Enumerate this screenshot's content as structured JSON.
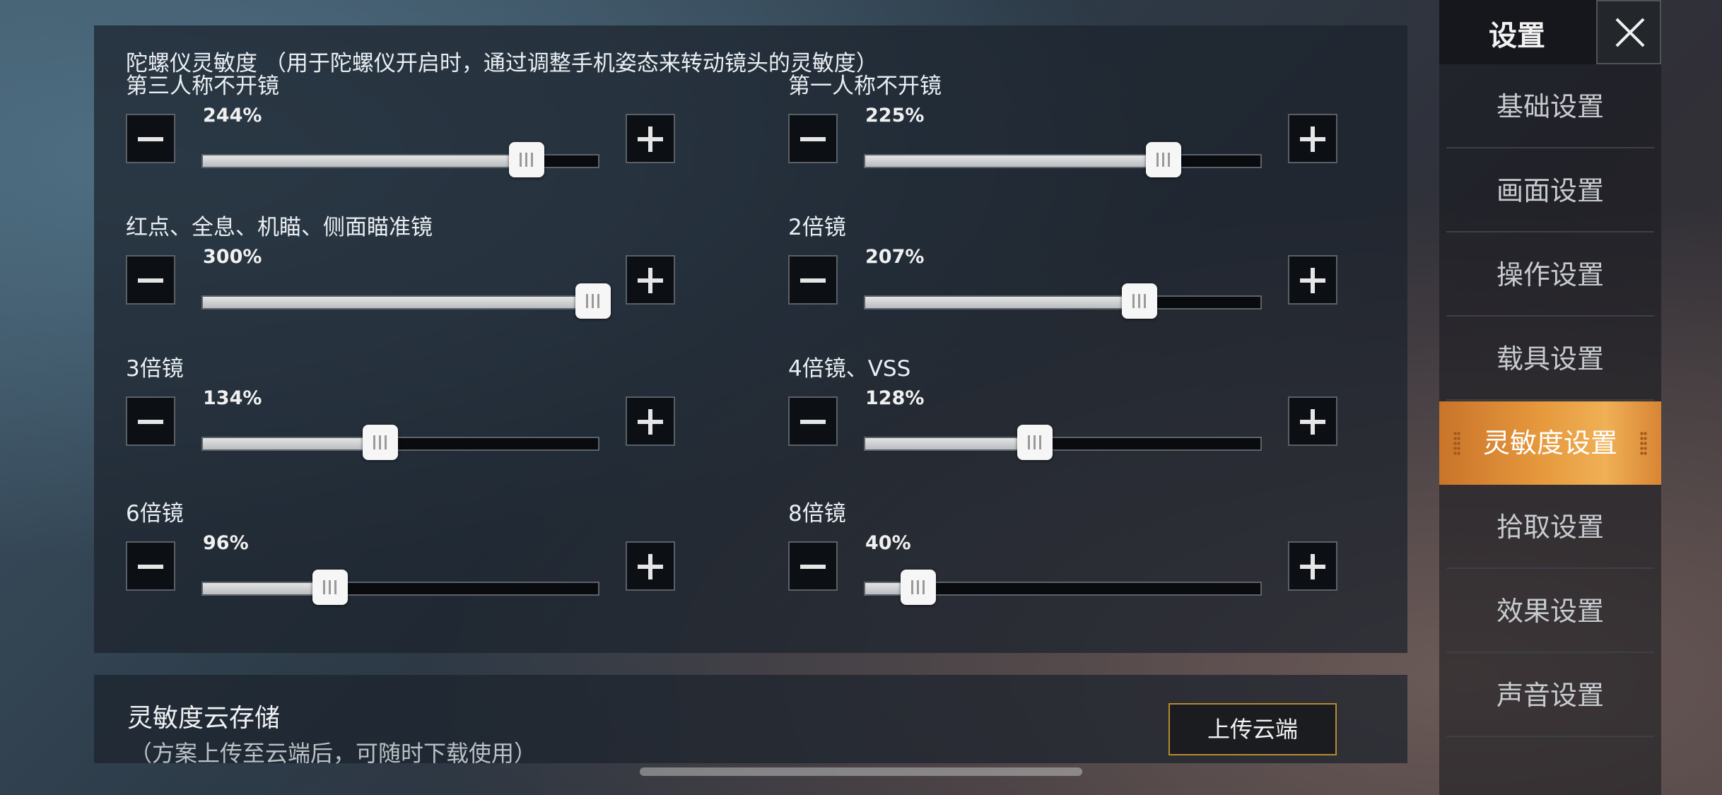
{
  "gyro": {
    "title": "陀螺仪灵敏度 （用于陀螺仪开启时，通过调整手机姿态来转动镜头的灵敏度）",
    "sliders": [
      {
        "label": "第三人称不开镜",
        "value_text": "244%",
        "value": 244
      },
      {
        "label": "第一人称不开镜",
        "value_text": "225%",
        "value": 225
      },
      {
        "label": "红点、全息、机瞄、侧面瞄准镜",
        "value_text": "300%",
        "value": 300
      },
      {
        "label": "2倍镜",
        "value_text": "207%",
        "value": 207
      },
      {
        "label": "3倍镜",
        "value_text": "134%",
        "value": 134
      },
      {
        "label": "4倍镜、VSS",
        "value_text": "128%",
        "value": 128
      },
      {
        "label": "6倍镜",
        "value_text": "96%",
        "value": 96
      },
      {
        "label": "8倍镜",
        "value_text": "40%",
        "value": 40
      }
    ],
    "min": 0,
    "max": 300
  },
  "cloud": {
    "title": "灵敏度云存储",
    "subtitle": "（方案上传至云端后，可随时下载使用）",
    "upload_label": "上传云端"
  },
  "sidebar": {
    "title": "设置",
    "items": [
      {
        "label": "基础设置"
      },
      {
        "label": "画面设置"
      },
      {
        "label": "操作设置"
      },
      {
        "label": "载具设置"
      },
      {
        "label": "灵敏度设置",
        "active": true
      },
      {
        "label": "拾取设置"
      },
      {
        "label": "效果设置"
      },
      {
        "label": "声音设置"
      }
    ]
  },
  "colors": {
    "accent": "#e6983c",
    "panel": "#1c222c",
    "button_border": "#b8892f"
  },
  "icons": {
    "close": "close-icon",
    "minus": "minus-icon",
    "plus": "plus-icon"
  }
}
